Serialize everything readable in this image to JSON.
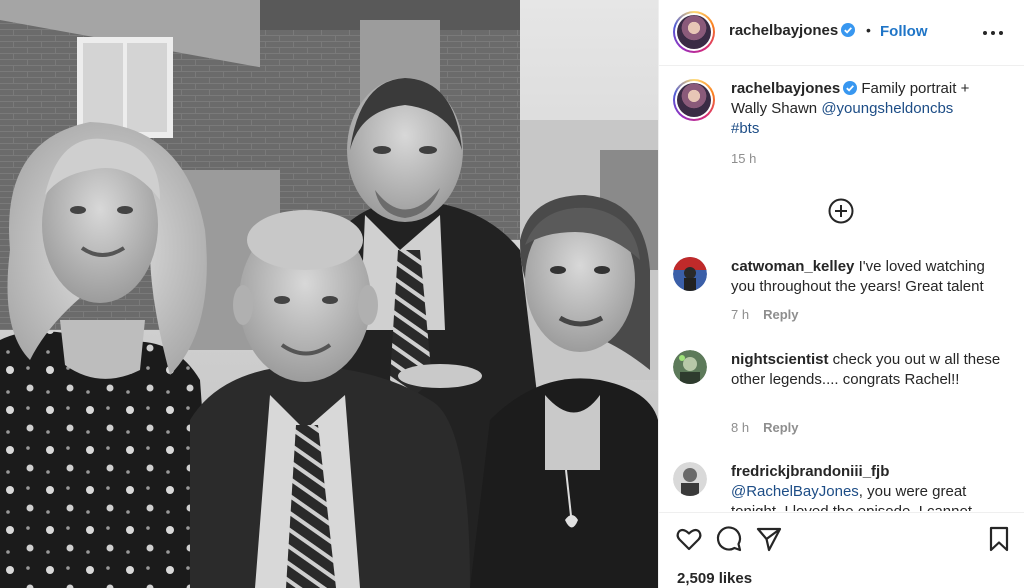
{
  "post": {
    "username": "rachelbayjones",
    "separator": "•",
    "follow_label": "Follow",
    "more_icon": "more-dots-icon",
    "verified_icon": "verified-badge-icon"
  },
  "caption": {
    "username": "rachelbayjones",
    "text_part1": " Family portrait + Wally Shawn ",
    "mention": "@youngsheldoncbs",
    "hashtag": "#bts",
    "time": "15 h"
  },
  "load_more_icon": "plus-circle-icon",
  "comments": [
    {
      "username": "catwoman_kelley",
      "text": " I've loved watching you throughout the years! Great talent",
      "time": "7 h",
      "reply_label": "Reply"
    },
    {
      "username": "nightscientist",
      "text": " check you out w all these other legends.... congrats Rachel!!",
      "time": "8 h",
      "reply_label": "Reply"
    },
    {
      "username": "fredrickjbrandoniii_fjb",
      "mention": "@RachelBayJones",
      "text": ", you were great tonight. I loved the episode. I cannot",
      "time": "",
      "reply_label": ""
    }
  ],
  "actions": {
    "like_icon": "heart-icon",
    "comment_icon": "comment-icon",
    "share_icon": "paper-plane-icon",
    "save_icon": "bookmark-icon",
    "likes": "2,509 likes"
  },
  "colors": {
    "link": "#1d4d86",
    "follow": "#1f75c7",
    "verified": "#3897f0",
    "muted": "#8e8e8e"
  }
}
